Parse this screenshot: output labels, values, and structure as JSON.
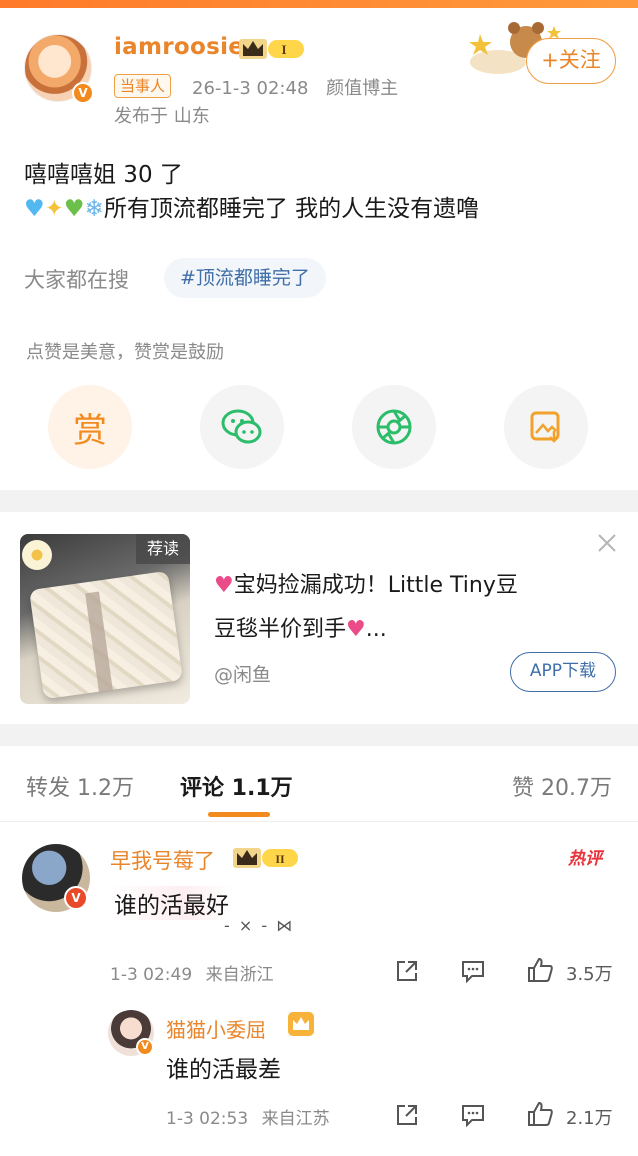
{
  "post": {
    "username": "iamroosie",
    "level_badge": "I",
    "tag": "当事人",
    "timestamp": "26-1-3 02:48",
    "role": "颜值博主",
    "location": "发布于 山东",
    "follow_label": "+关注",
    "content_line1": "嘻嘻嘻姐 30 了",
    "content_line2_text": "所有顶流都睡完了 我的人生没有遗噜",
    "search_label": "大家都在搜",
    "hashtag": "#顶流都睡完了",
    "reward_note": "点赞是美意，赞赏是鼓励",
    "reward_char": "赏"
  },
  "ad": {
    "tag": "荐读",
    "title_line1": "宝妈捡漏成功！Little Tiny豆",
    "title_line2": "豆毯半价到手",
    "ellipsis": "...",
    "source": "@闲鱼",
    "button": "APP下载"
  },
  "tabs": {
    "repost": "转发 1.2万",
    "comment": "评论 1.1万",
    "like": "赞 20.7万"
  },
  "comments": [
    {
      "name": "早我号莓了",
      "level_badge": "II",
      "hot": "热评",
      "text": "谁的活最好",
      "deco": "- × - ",
      "time": "1-3 02:49",
      "region": "来自浙江",
      "likes": "3.5万"
    }
  ],
  "reply": {
    "name": "猫猫小委屈",
    "text": "谁的活最差",
    "time": "1-3 02:53",
    "region": "来自江苏",
    "likes": "2.1万"
  },
  "colors": {
    "accent": "#f28a1e",
    "link": "#3f6ea8",
    "hot": "#e8323c"
  }
}
